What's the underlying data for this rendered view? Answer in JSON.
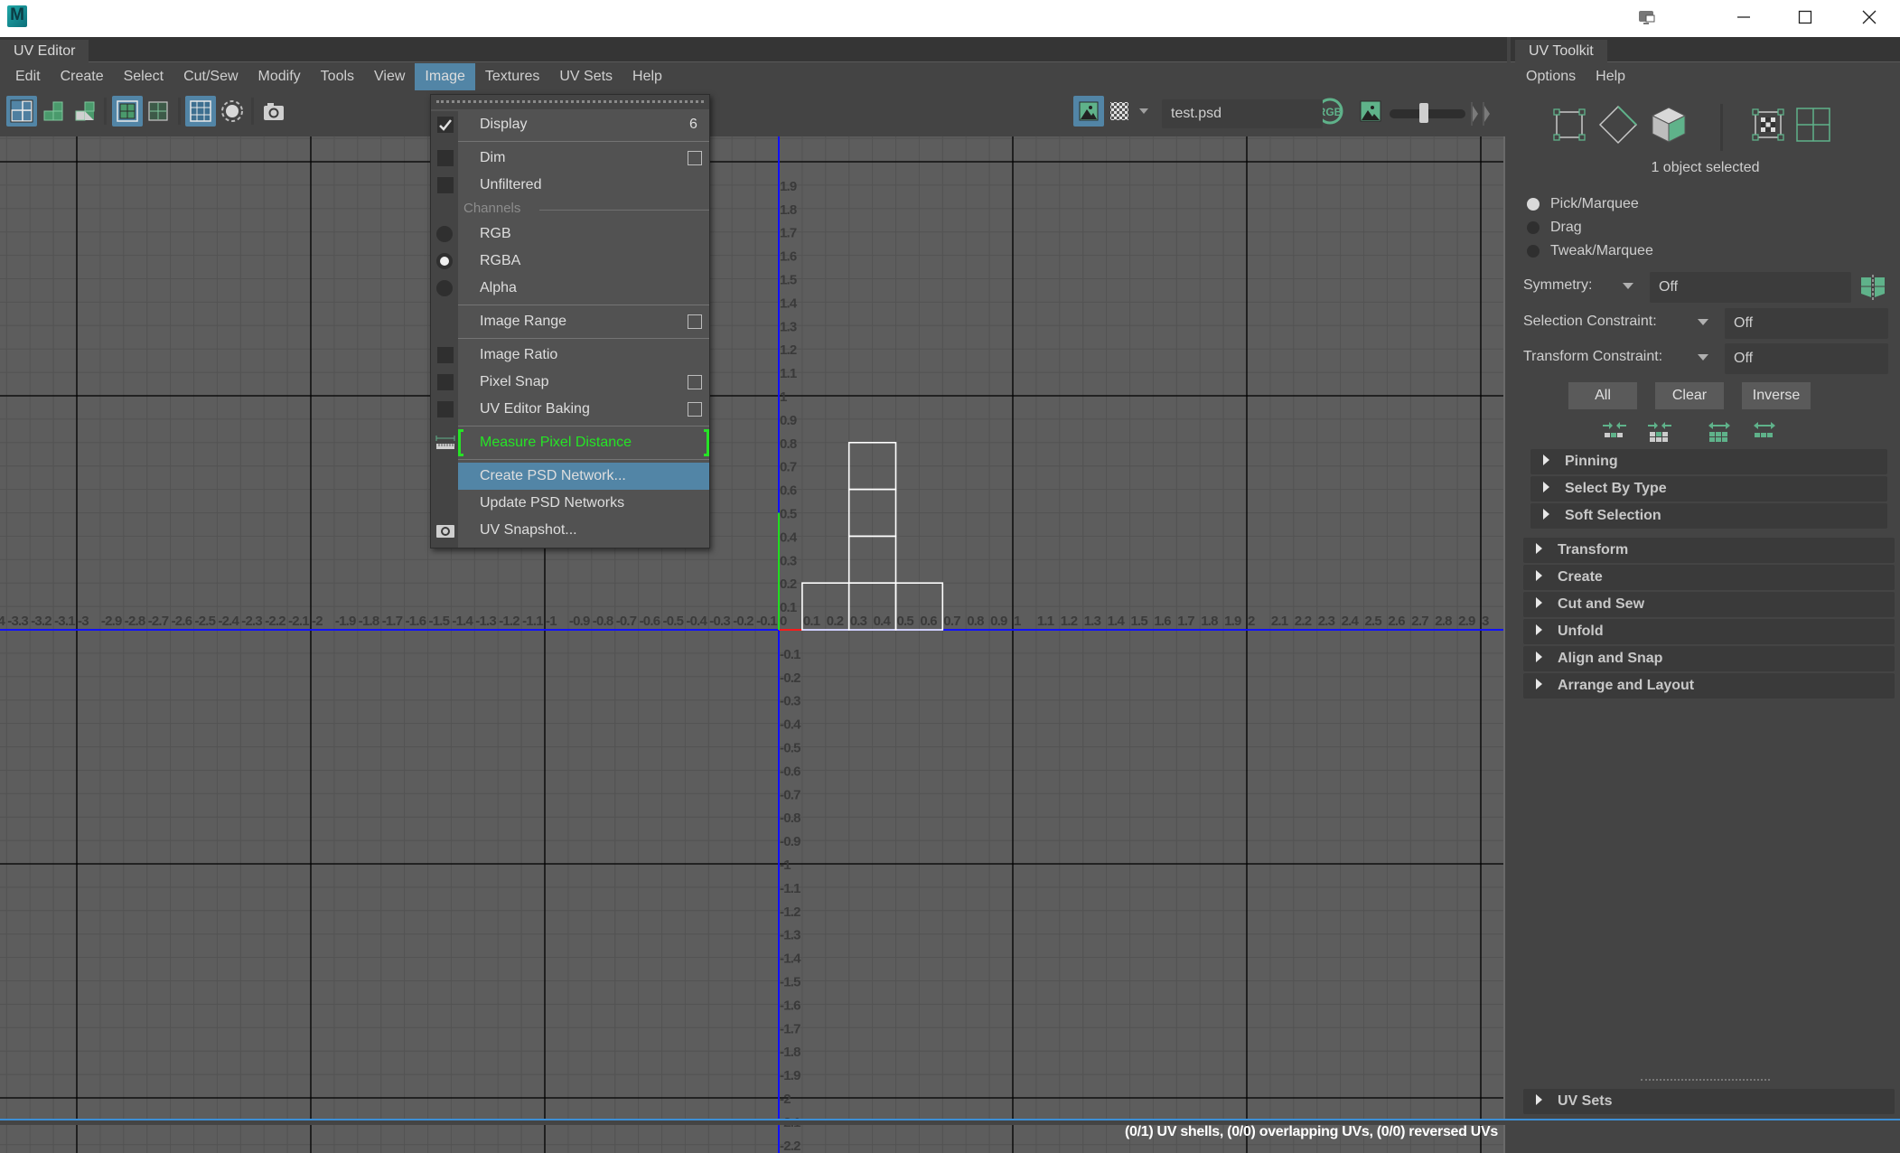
{
  "window": {
    "app_icon_letter": "M",
    "controls": [
      "display-settings",
      "minimize",
      "maximize",
      "close"
    ]
  },
  "uv_editor": {
    "tab_label": "UV Editor",
    "menu": [
      "Edit",
      "Create",
      "Select",
      "Cut/Sew",
      "Modify",
      "Tools",
      "View",
      "Image",
      "Textures",
      "UV Sets",
      "Help"
    ],
    "active_menu": "Image",
    "toolbar": {
      "left_icons": [
        {
          "name": "uv-shell-selection-icon",
          "on": true
        },
        {
          "name": "uv-shell-green-icon",
          "on": false
        },
        {
          "name": "uv-shell-half-icon",
          "on": false
        },
        {
          "name": "grid-display-icon",
          "on": true
        },
        {
          "name": "grid-outline-icon",
          "on": false
        },
        {
          "name": "pixel-grid-icon",
          "on": true
        },
        {
          "name": "shaded-uv-icon",
          "on": false
        },
        {
          "name": "uv-snapshot-icon",
          "on": false
        }
      ],
      "image_toggle_on": true,
      "texture_name": "test.psd",
      "channel_label": "RGB",
      "exposure_slider": 0.35
    },
    "status_text": "(0/1) UV shells, (0/0) overlapping UVs, (0/0) reversed UVs"
  },
  "image_menu": {
    "items": [
      {
        "type": "item",
        "label": "Display",
        "value": "6",
        "gutter": "check"
      },
      {
        "type": "sep"
      },
      {
        "type": "item",
        "label": "Dim",
        "gutter": "box",
        "checkbox": false
      },
      {
        "type": "item",
        "label": "Unfiltered",
        "gutter": "box"
      },
      {
        "type": "section",
        "label": "Channels"
      },
      {
        "type": "item",
        "label": "RGB",
        "gutter": "radio",
        "selected": false
      },
      {
        "type": "item",
        "label": "RGBA",
        "gutter": "radio",
        "selected": true
      },
      {
        "type": "item",
        "label": "Alpha",
        "gutter": "radio",
        "selected": false
      },
      {
        "type": "sep"
      },
      {
        "type": "item",
        "label": "Image Range",
        "checkbox": false
      },
      {
        "type": "sep"
      },
      {
        "type": "item",
        "label": "Image Ratio",
        "gutter": "box"
      },
      {
        "type": "item",
        "label": "Pixel Snap",
        "gutter": "box",
        "checkbox": false
      },
      {
        "type": "item",
        "label": "UV Editor Baking",
        "gutter": "box",
        "checkbox": false
      },
      {
        "type": "sep"
      },
      {
        "type": "item",
        "label": "Measure Pixel Distance",
        "gutter": "ruler",
        "green": true
      },
      {
        "type": "sep"
      },
      {
        "type": "item",
        "label": "Create PSD Network...",
        "highlighted": true
      },
      {
        "type": "item",
        "label": "Update PSD Networks"
      },
      {
        "type": "item",
        "label": "UV Snapshot...",
        "gutter": "camera"
      }
    ]
  },
  "uv_grid": {
    "u_range": [
      -3.4,
      3.0
    ],
    "v_range": [
      -2.2,
      1.9
    ],
    "major_step": 1,
    "minor_step": 0.1,
    "colors": {
      "background": "#5d5d5d",
      "minor": "#535353",
      "major": "#000000",
      "u_axis": "#1010ff",
      "v_axis": "#1010ff",
      "label": "#3a3a3a",
      "uv_edges": "#ffffff",
      "u_positive": "#ff1a1a",
      "v_positive": "#20dd20"
    },
    "uv_quads": [
      {
        "u": [
          0.1,
          0.3
        ],
        "v": [
          0.0,
          0.2
        ]
      },
      {
        "u": [
          0.3,
          0.5
        ],
        "v": [
          0.0,
          0.2
        ]
      },
      {
        "u": [
          0.5,
          0.7
        ],
        "v": [
          0.0,
          0.2
        ]
      },
      {
        "u": [
          0.3,
          0.5
        ],
        "v": [
          0.2,
          0.4
        ]
      },
      {
        "u": [
          0.3,
          0.5
        ],
        "v": [
          0.4,
          0.6
        ]
      },
      {
        "u": [
          0.3,
          0.5
        ],
        "v": [
          0.6,
          0.8
        ]
      }
    ]
  },
  "uv_toolkit": {
    "tab_label": "UV Toolkit",
    "menu": [
      "Options",
      "Help"
    ],
    "selection_icons": [
      "vertex-mode-icon",
      "edge-mode-icon",
      "face-mode-icon",
      "uv-mode-icon",
      "uv-shell-mode-icon"
    ],
    "selection_info": "1 object selected",
    "tool_modes": [
      {
        "label": "Pick/Marquee",
        "selected": true
      },
      {
        "label": "Drag",
        "selected": false
      },
      {
        "label": "Tweak/Marquee",
        "selected": false
      }
    ],
    "symmetry": {
      "label": "Symmetry:",
      "value": "Off"
    },
    "selection_constraint": {
      "label": "Selection Constraint:",
      "value": "Off"
    },
    "transform_constraint": {
      "label": "Transform Constraint:",
      "value": "Off"
    },
    "buttons": [
      "All",
      "Clear",
      "Inverse"
    ],
    "grow_shrink_icons": [
      "shrink-selection-icon",
      "shrink-loop-icon",
      "grow-selection-icon",
      "grow-loop-icon"
    ],
    "sub_sections": [
      "Pinning",
      "Select By Type",
      "Soft Selection"
    ],
    "sections": [
      "Transform",
      "Create",
      "Cut and Sew",
      "Unfold",
      "Align and Snap",
      "Arrange and Layout"
    ],
    "footer_section": "UV Sets"
  }
}
